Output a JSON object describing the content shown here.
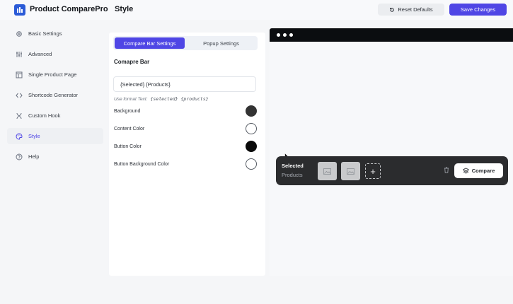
{
  "app": {
    "name": "Product ComparePro"
  },
  "header": {
    "title": "Style",
    "reset_label": "Reset Defaults",
    "save_label": "Save Changes"
  },
  "sidebar": {
    "items": [
      {
        "label": "Basic Settings",
        "icon": "gear-icon"
      },
      {
        "label": "Advanced",
        "icon": "sliders-icon"
      },
      {
        "label": "Single Product Page",
        "icon": "page-icon"
      },
      {
        "label": "Shortcode Generator",
        "icon": "code-icon"
      },
      {
        "label": "Custom Hook",
        "icon": "hook-icon"
      },
      {
        "label": "Style",
        "icon": "palette-icon",
        "active": true
      },
      {
        "label": "Help",
        "icon": "help-icon"
      }
    ]
  },
  "settings": {
    "tabs": [
      {
        "label": "Compare Bar Settings",
        "active": true
      },
      {
        "label": "Popup Settings",
        "active": false
      }
    ],
    "section_title": "Comapre Bar",
    "text_field_value": "{Selected} {Products}",
    "hint_label": "Use format Text:",
    "hint_code": "{selected} {products}",
    "colors": [
      {
        "label": "Background",
        "value": "#333333"
      },
      {
        "label": "Content Color",
        "value": "#ffffff"
      },
      {
        "label": "Button Color",
        "value": "#0a0a0a"
      },
      {
        "label": "Button Background Color",
        "value": "#ffffff"
      }
    ]
  },
  "preview": {
    "bar": {
      "selected_label": "Selected",
      "products_label": "Products",
      "compare_label": "Compare",
      "product_slots": 2
    }
  },
  "colors": {
    "accent": "#4f46e5",
    "compare_bar_bg": "#2b2c2e"
  }
}
